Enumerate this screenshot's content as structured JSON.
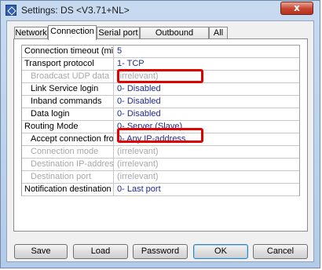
{
  "window": {
    "title": "Settings: DS <V3.71+NL>",
    "close_glyph": "x",
    "app_icon": "settings-app-icon"
  },
  "tabs": [
    {
      "label": "Network"
    },
    {
      "label": "Connection"
    },
    {
      "label": "Serial port"
    },
    {
      "label": "Outbound packets"
    },
    {
      "label": "All"
    }
  ],
  "active_tab": "Connection",
  "settings": [
    {
      "label": "Connection timeout (min)",
      "value": "5"
    },
    {
      "label": "Transport protocol",
      "value": "1- TCP"
    },
    {
      "label": "Broadcast UDP data",
      "value": "(irrelevant)"
    },
    {
      "label": "Link Service login",
      "value": "0- Disabled"
    },
    {
      "label": "Inband commands",
      "value": "0- Disabled"
    },
    {
      "label": "Data login",
      "value": "0- Disabled"
    },
    {
      "label": "Routing Mode",
      "value": "0- Server (Slave)"
    },
    {
      "label": "Accept connection from",
      "value": "0- Any IP-address"
    },
    {
      "label": "Connection mode",
      "value": "(irrelevant)"
    },
    {
      "label": "Destination IP-address",
      "value": "(irrelevant)"
    },
    {
      "label": "Destination port",
      "value": "(irrelevant)"
    },
    {
      "label": "Notification destination",
      "value": "0- Last port"
    }
  ],
  "buttons": {
    "save": "Save",
    "load": "Load",
    "password": "Password",
    "ok": "OK",
    "cancel": "Cancel"
  },
  "highlight_color": "#e00000"
}
